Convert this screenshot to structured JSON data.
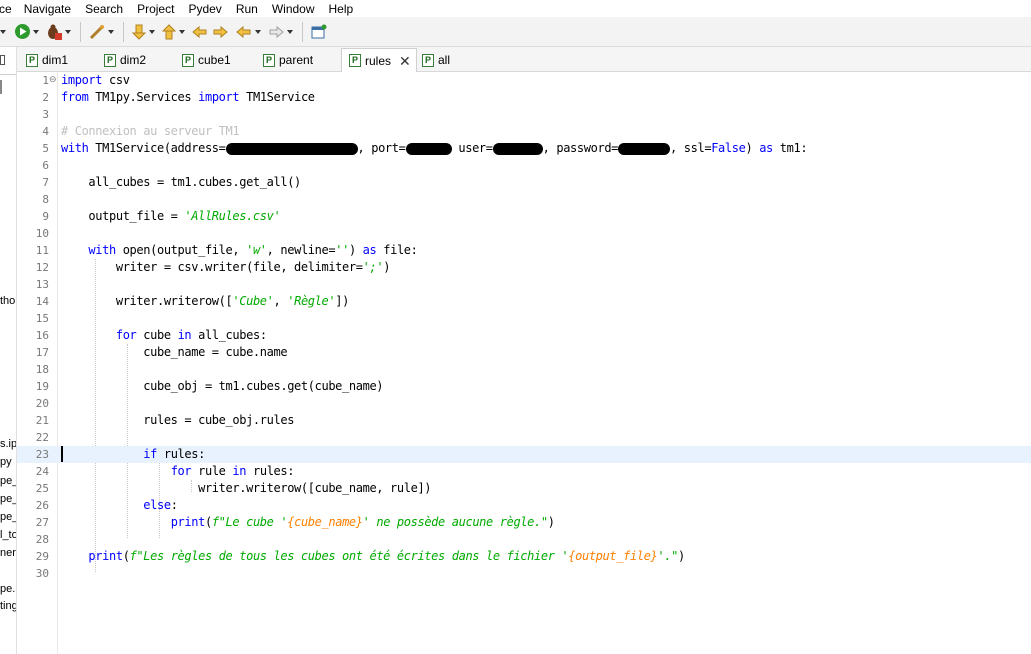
{
  "menubar": {
    "items": [
      "ce",
      "Navigate",
      "Search",
      "Project",
      "Pydev",
      "Run",
      "Window",
      "Help"
    ]
  },
  "toolbar": {
    "buttons": [
      "run-icon",
      "debug-icon",
      "wand-icon",
      "down-arrow-icon",
      "up-arrow-icon",
      "back-icon",
      "forward-icon",
      "nav-back-icon",
      "nav-forward-icon",
      "new-window-icon"
    ]
  },
  "leftpanel": {
    "fragments": [
      "tho",
      "s.ip",
      "py",
      "pe_",
      "pe_",
      "pe_",
      "l_to",
      "ners",
      "pe.p",
      "ting"
    ]
  },
  "tabs": [
    {
      "label": "dim1",
      "active": false
    },
    {
      "label": "dim2",
      "active": false
    },
    {
      "label": "cube1",
      "active": false
    },
    {
      "label": "parent",
      "active": false
    },
    {
      "label": "rules",
      "active": true
    },
    {
      "label": "all",
      "active": false
    }
  ],
  "editor": {
    "current_line": 23,
    "line_numbers": [
      "1",
      "2",
      "3",
      "4",
      "5",
      "6",
      "7",
      "8",
      "9",
      "10",
      "11",
      "12",
      "13",
      "14",
      "15",
      "16",
      "17",
      "18",
      "19",
      "20",
      "21",
      "22",
      "23",
      "24",
      "25",
      "26",
      "27",
      "28",
      "29",
      "30"
    ],
    "code": {
      "l1_kw": "import",
      "l1_rest": " csv",
      "l2_kw1": "from",
      "l2_mid": " TM1py.Services ",
      "l2_kw2": "import",
      "l2_rest": " TM1Service",
      "l4_comment": "# Connexion au serveur TM1",
      "l5_kw": "with",
      "l5_a": " TM1Service(address=",
      "l5_b": ", port=",
      "l5_c": " user=",
      "l5_d": ", password=",
      "l5_e": ", ssl=",
      "l5_false": "False",
      "l5_f": ") ",
      "l5_as": "as",
      "l5_g": " tm1:",
      "l7": "    all_cubes = tm1.cubes.get_all()",
      "l9_a": "    output_file = ",
      "l9_str": "'AllRules.csv'",
      "l11_ind": "    ",
      "l11_with": "with",
      "l11_a": " open(output_file, ",
      "l11_w": "'w'",
      "l11_b": ", newline=",
      "l11_nl": "''",
      "l11_c": ") ",
      "l11_as": "as",
      "l11_d": " file:",
      "l12_a": "        writer = csv.writer(file, delimiter=",
      "l12_str": "';'",
      "l12_b": ")",
      "l14_a": "        writer.writerow([",
      "l14_s1": "'Cube'",
      "l14_b": ", ",
      "l14_s2": "'Règle'",
      "l14_c": "])",
      "l16_ind": "        ",
      "l16_for": "for",
      "l16_a": " cube ",
      "l16_in": "in",
      "l16_b": " all_cubes:",
      "l17": "            cube_name = cube.name",
      "l19": "            cube_obj = tm1.cubes.get(cube_name)",
      "l21": "            rules = cube_obj.rules",
      "l23_ind": "            ",
      "l23_if": "if",
      "l23_a": " rules:",
      "l24_ind": "                ",
      "l24_for": "for",
      "l24_a": " rule ",
      "l24_in": "in",
      "l24_b": " rules:",
      "l25": "                    writer.writerow([cube_name, rule])",
      "l26_ind": "            ",
      "l26_else": "else",
      "l26_a": ":",
      "l27_ind": "                ",
      "l27_print": "print",
      "l27_a": "(",
      "l27_s1": "f\"Le cube '",
      "l27_v": "{cube_name}",
      "l27_s2": "' ne possède aucune règle.\"",
      "l27_b": ")",
      "l29_ind": "    ",
      "l29_print": "print",
      "l29_a": "(",
      "l29_s1": "f\"Les règles de tous les cubes ont été écrites dans le fichier '",
      "l29_v": "{output_file}",
      "l29_s2": "'.\"",
      "l29_b": ")"
    }
  }
}
